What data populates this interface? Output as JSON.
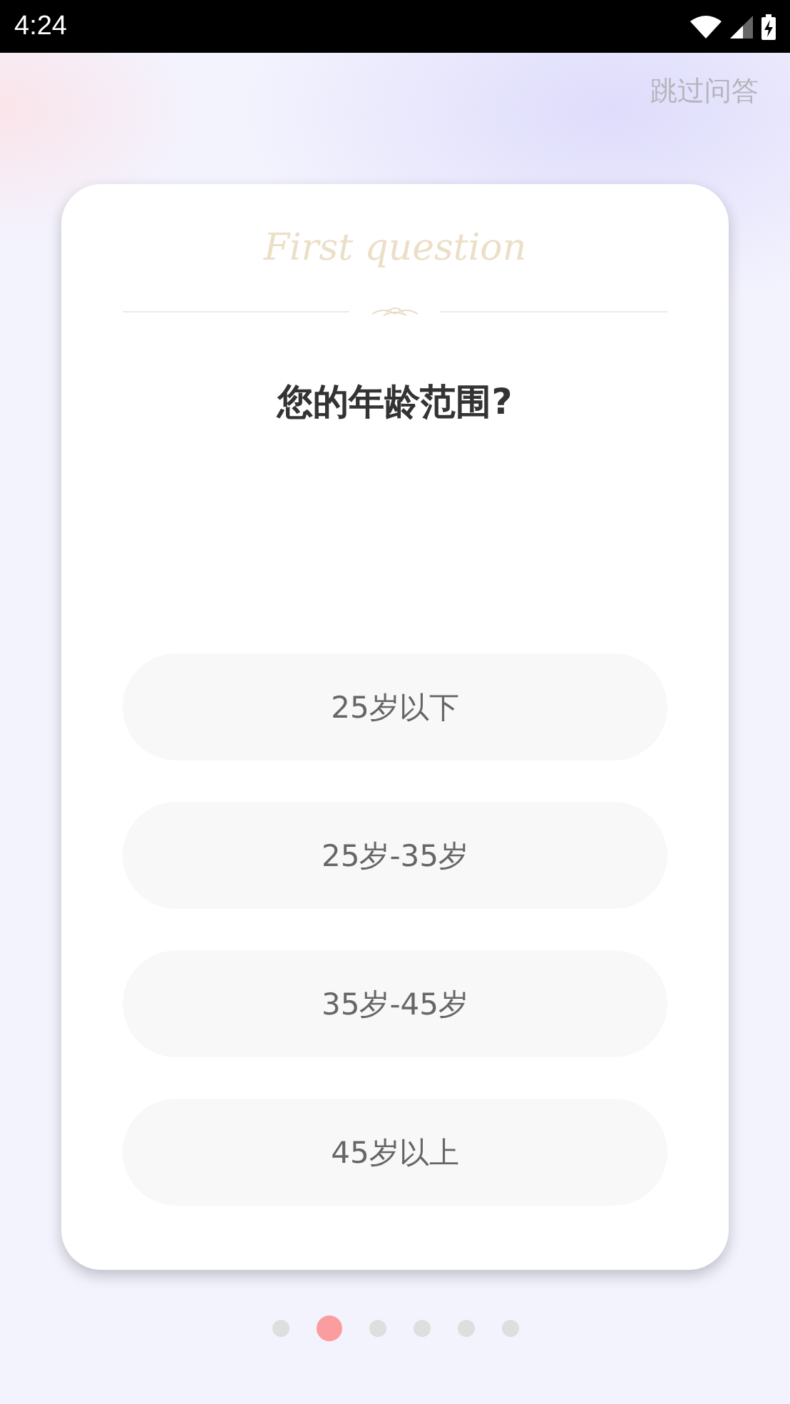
{
  "status_bar": {
    "time": "4:24"
  },
  "skip_link": "跳过问答",
  "card": {
    "heading": "First question",
    "question": "您的年龄范围?",
    "options": [
      {
        "label": "25岁以下"
      },
      {
        "label": "25岁-35岁"
      },
      {
        "label": "35岁-45岁"
      },
      {
        "label": "45岁以上"
      }
    ]
  },
  "pager": [
    {
      "selected": false
    },
    {
      "selected": true
    },
    {
      "selected": false
    },
    {
      "selected": false
    },
    {
      "selected": false
    },
    {
      "selected": false
    }
  ]
}
